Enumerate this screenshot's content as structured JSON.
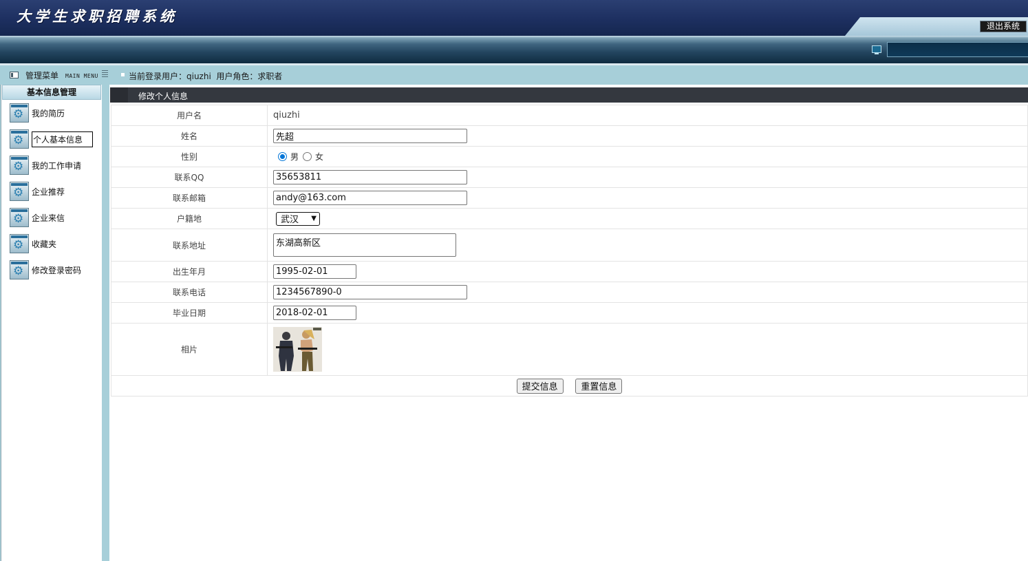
{
  "header": {
    "title": "大学生求职招聘系统",
    "logout_label": "退出系统"
  },
  "sidebar": {
    "menu_title": "管理菜单",
    "menu_subtitle": "MAIN MENU",
    "group_title": "基本信息管理",
    "items": [
      {
        "label": "我的简历"
      },
      {
        "label": "个人基本信息",
        "active": true
      },
      {
        "label": "我的工作申请"
      },
      {
        "label": "企业推荐"
      },
      {
        "label": "企业来信"
      },
      {
        "label": "收藏夹"
      },
      {
        "label": "修改登录密码"
      }
    ]
  },
  "infobar": {
    "text": "当前登录用户：qiuzhi  用户角色：求职者"
  },
  "panel": {
    "title": "修改个人信息"
  },
  "form": {
    "username": {
      "label": "用户名",
      "value": "qiuzhi"
    },
    "name": {
      "label": "姓名",
      "value": "先超"
    },
    "gender": {
      "label": "性别",
      "options": [
        "男",
        "女"
      ],
      "selected": "男"
    },
    "qq": {
      "label": "联系QQ",
      "value": "35653811"
    },
    "email": {
      "label": "联系邮箱",
      "value": "andy@163.com"
    },
    "hometown": {
      "label": "户籍地",
      "value": "武汉"
    },
    "address": {
      "label": "联系地址",
      "value": "东湖高新区"
    },
    "birth": {
      "label": "出生年月",
      "value": "1995-02-01"
    },
    "phone": {
      "label": "联系电话",
      "value": "1234567890-0"
    },
    "graduate": {
      "label": "毕业日期",
      "value": "2018-02-01"
    },
    "photo": {
      "label": "相片"
    }
  },
  "buttons": {
    "submit_label": "提交信息",
    "reset_label": "重置信息"
  }
}
